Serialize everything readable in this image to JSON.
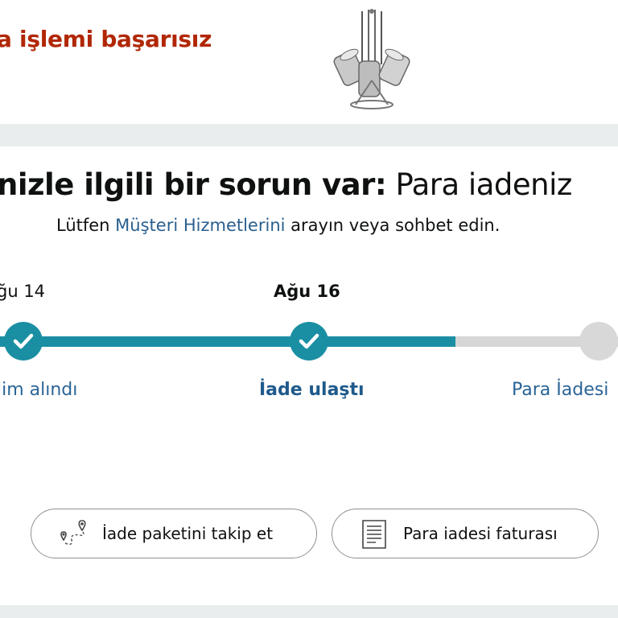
{
  "header": {
    "status_title": "a işlemi başarısız",
    "product_image_alt": "metal pot and pan rack"
  },
  "issue": {
    "heading_bold": "nizle ilgili bir sorun var:",
    "heading_rest": " Para iadeniz",
    "help_prefix": "Lütfen ",
    "help_link": "Müşteri Hizmetlerini",
    "help_suffix": " arayın veya sohbet edin."
  },
  "timeline": {
    "steps": [
      {
        "date": "ğu 14",
        "label": "lim alındı",
        "state": "done"
      },
      {
        "date": "Ağu 16",
        "label": "İade ulaştı",
        "state": "done"
      },
      {
        "date": "",
        "label": "Para İadesi",
        "state": "pending"
      }
    ]
  },
  "actions": {
    "track_label": "İade paketini takip et",
    "invoice_label": "Para iadesi faturası"
  },
  "colors": {
    "accent": "#1a8fa3",
    "error": "#b12704",
    "link": "#2a5f8f",
    "pending": "#d6d6d6"
  },
  "icons": [
    "checkmark-icon",
    "route-map-icon",
    "receipt-icon"
  ]
}
